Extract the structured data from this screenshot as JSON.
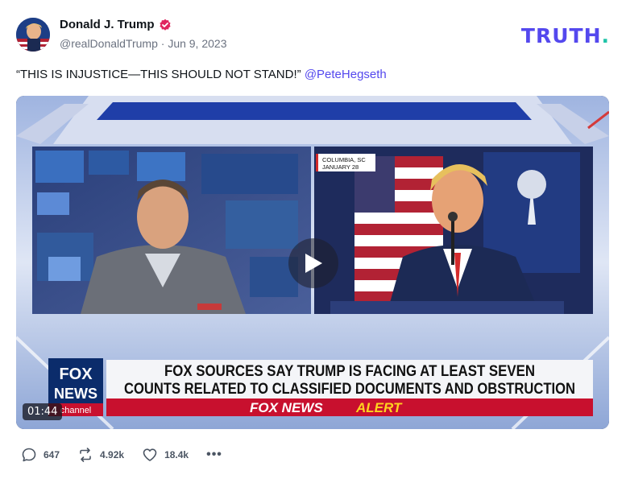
{
  "post": {
    "display_name": "Donald J. Trump",
    "handle": "@realDonaldTrump",
    "separator": "·",
    "date": "Jun 9, 2023",
    "text": "“THIS IS INJUSTICE—THIS SHOULD NOT STAND!”",
    "mention": "@PeteHegseth"
  },
  "brand": {
    "logo_main": "TRUTH",
    "logo_dot": ".",
    "accent_color": "#5448ee",
    "dot_color": "#20c4a8"
  },
  "video": {
    "duration": "01:44",
    "location_tag_line1": "COLUMBIA, SC",
    "location_tag_line2": "JANUARY 28",
    "headline_line1": "FOX SOURCES SAY TRUMP IS FACING AT LEAST SEVEN",
    "headline_line2": "COUNTS RELATED TO CLASSIFIED DOCUMENTS AND OBSTRUCTION",
    "alert_part1": "FOX NEWS",
    "alert_part2": "ALERT",
    "channel_logo_line1": "FOX",
    "channel_logo_line2": "NEWS",
    "channel_logo_line3": "channel"
  },
  "actions": {
    "replies": "647",
    "reposts": "4.92k",
    "likes": "18.4k",
    "more": "•••"
  }
}
